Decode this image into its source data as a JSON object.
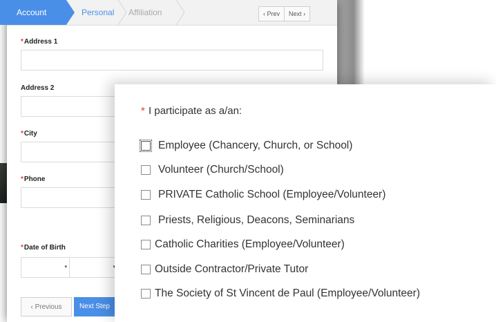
{
  "wizard": {
    "steps": [
      "Account",
      "Personal",
      "Affiliation"
    ],
    "prev_label": "Prev",
    "next_label": "Next",
    "prev_icon": "chevron-left-icon",
    "next_icon": "chevron-right-icon"
  },
  "form": {
    "required_mark": "*",
    "fields": {
      "address1": "Address 1",
      "address2": "Address 2",
      "city": "City",
      "phone": "Phone",
      "dob": "Date of Birth"
    },
    "select_caret": "▾",
    "previous_button": "‹ Previous",
    "next_step_button": "Next Step"
  },
  "popup": {
    "required_mark": "*",
    "question": "I participate as a/an:",
    "options": [
      "Employee (Chancery, Church, or School)",
      "Volunteer (Church/School)",
      "PRIVATE Catholic School (Employee/Volunteer)",
      "Priests, Religious, Deacons, Seminarians",
      "Catholic Charities (Employee/Volunteer)",
      "Outside Contractor/Private Tutor",
      "The Society of St Vincent de Paul (Employee/Volunteer)"
    ]
  },
  "colors": {
    "accent": "#4a8fe7",
    "required": "#e53935"
  }
}
